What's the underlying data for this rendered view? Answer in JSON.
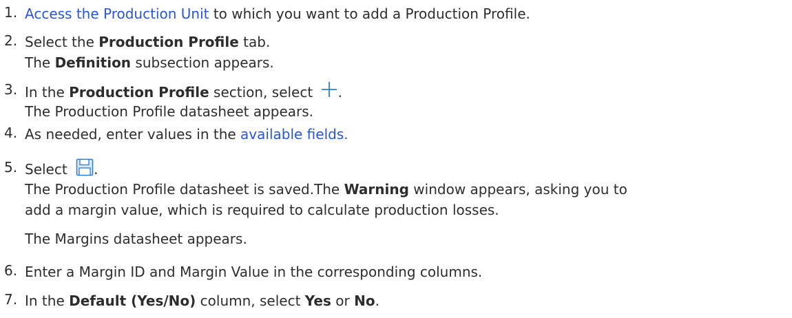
{
  "steps": [
    {
      "number": "1.",
      "parts": {
        "link": "Access the Production Unit",
        "rest": " to which you want to add a Production Profile."
      }
    },
    {
      "number": "2.",
      "parts": {
        "pre": "Select the ",
        "bold": "Production Profile",
        "post": " tab."
      },
      "result": {
        "pre": "The ",
        "bold": "Definition",
        "post": " subsection appears."
      }
    },
    {
      "number": "3.",
      "parts": {
        "pre": "In the ",
        "bold": "Production Profile",
        "post": " section, select ",
        "end": "."
      },
      "icon": "plus-icon",
      "result": {
        "text": "The Production Profile datasheet appears."
      }
    },
    {
      "number": "4.",
      "parts": {
        "pre": "As needed, enter values in the ",
        "link": "available fields."
      }
    },
    {
      "number": "5.",
      "parts": {
        "pre": "Select ",
        "end": "."
      },
      "icon": "save-icon",
      "result": {
        "pre": "The Production Profile datasheet is saved.The ",
        "bold": "Warning",
        "post": " window appears, asking you to",
        "line2": "add a margin value, which is required to calculate production losses.",
        "line3": "The Margins datasheet appears."
      }
    },
    {
      "number": "6.",
      "parts": {
        "text": "Enter a Margin ID and Margin Value in the corresponding columns."
      }
    },
    {
      "number": "7.",
      "parts": {
        "pre": "In the ",
        "bold": "Default (Yes/No)",
        "post": " column, select ",
        "bold2": "Yes",
        "or": " or ",
        "bold3": "No",
        "end": "."
      }
    }
  ],
  "colors": {
    "text": "#2d2d2d",
    "link": "#2855d9",
    "icon_blue": "#2b7bd6"
  }
}
